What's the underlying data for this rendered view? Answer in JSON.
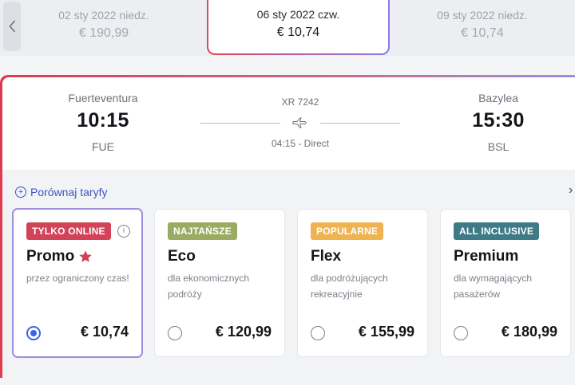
{
  "date_strip": {
    "dates": [
      {
        "label": "02 sty 2022 niedz.",
        "price": "€ 190,99"
      },
      {
        "label": "06 sty 2022 czw.",
        "price": "€ 10,74"
      },
      {
        "label": "09 sty 2022 niedz.",
        "price": "€ 10,74"
      }
    ]
  },
  "flight": {
    "origin": {
      "city": "Fuerteventura",
      "time": "10:15",
      "code": "FUE"
    },
    "destination": {
      "city": "Bazylea",
      "time": "15:30",
      "code": "BSL"
    },
    "flight_number": "XR 7242",
    "duration": "04:15 - Direct"
  },
  "compare_link": "Porównaj taryfy",
  "fares": [
    {
      "badge": "TYLKO ONLINE",
      "badge_color": "#d24258",
      "name": "Promo",
      "description": "przez ograniczony czas!",
      "price": "€ 10,74",
      "selected": true
    },
    {
      "badge": "NAJTAŃSZE",
      "badge_color": "#9aab62",
      "name": "Eco",
      "description": "dla ekonomicznych podróży",
      "price": "€ 120,99",
      "selected": false
    },
    {
      "badge": "POPULARNE",
      "badge_color": "#efb352",
      "name": "Flex",
      "description": "dla podróżujących rekreacyjnie",
      "price": "€ 155,99",
      "selected": false
    },
    {
      "badge": "ALL INCLUSIVE",
      "badge_color": "#3e7b86",
      "name": "Premium",
      "description": "dla wymagających pasażerów",
      "price": "€ 180,99",
      "selected": false
    }
  ],
  "icons": {
    "prev": "chevron-left-icon",
    "plane": "plane-icon",
    "star": "star-icon",
    "info": "info-icon",
    "compare": "plus-circle-icon",
    "next": "chevron-right-icon"
  }
}
